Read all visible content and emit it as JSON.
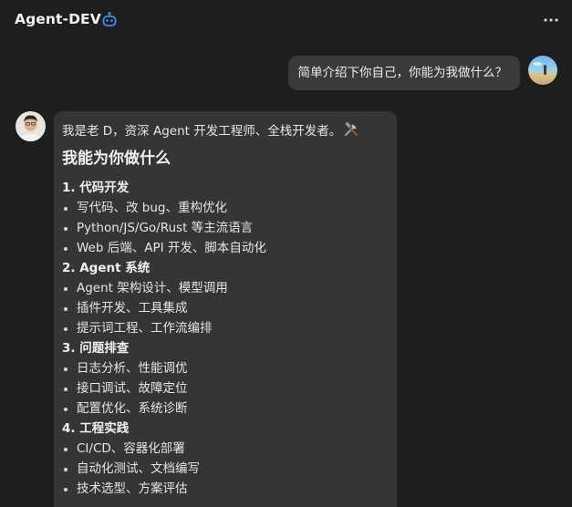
{
  "header": {
    "title": "Agent-DEV",
    "bot_icon": "robot-icon",
    "more_icon": "more-horizontal-icon"
  },
  "user_message": {
    "text": "简单介绍下你自己，你能为我做什么？",
    "avatar": "user-avatar"
  },
  "agent_message": {
    "intro": "我是老 D，资深 Agent 开发工程师、全栈开发者。",
    "intro_icon": "hammer-wrench-icon",
    "heading": "我能为你做什么",
    "sections": [
      {
        "title": "1. 代码开发",
        "items": [
          "写代码、改 bug、重构优化",
          "Python/JS/Go/Rust 等主流语言",
          "Web 后端、API 开发、脚本自动化"
        ]
      },
      {
        "title": "2. Agent 系统",
        "items": [
          "Agent 架构设计、模型调用",
          "插件开发、工具集成",
          "提示词工程、工作流编排"
        ]
      },
      {
        "title": "3. 问题排查",
        "items": [
          "日志分析、性能调优",
          "接口调试、故障定位",
          "配置优化、系统诊断"
        ]
      },
      {
        "title": "4. 工程实践",
        "items": [
          "CI/CD、容器化部署",
          "自动化测试、文档编写",
          "技术选型、方案评估"
        ]
      }
    ]
  },
  "colors": {
    "background": "#1e1e1e",
    "user_bubble": "#3a3a3a",
    "agent_bubble": "#353535",
    "accent_icon": "#3b8cf5"
  }
}
